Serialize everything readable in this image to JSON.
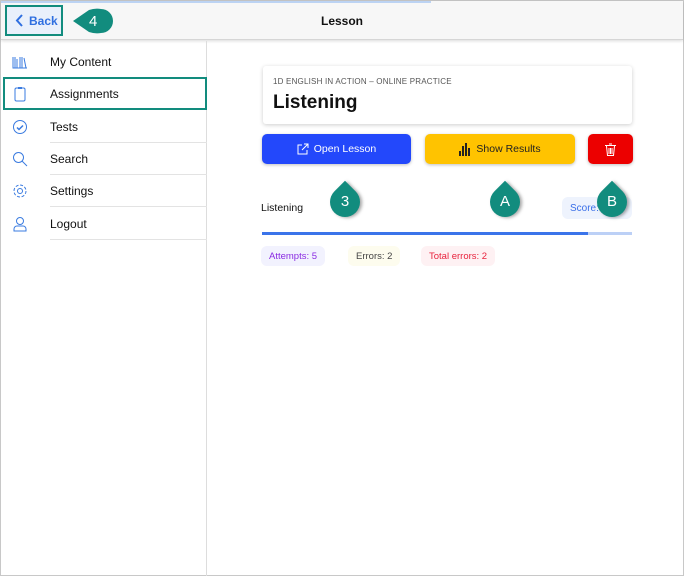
{
  "header": {
    "title": "Lesson",
    "back_label": "Back"
  },
  "sidebar": {
    "items": [
      {
        "label": "My Content",
        "icon": "books-icon"
      },
      {
        "label": "Assignments",
        "icon": "clipboard-icon",
        "selected": true
      },
      {
        "label": "Tests",
        "icon": "check-circle-icon"
      },
      {
        "label": "Search",
        "icon": "search-icon"
      },
      {
        "label": "Settings",
        "icon": "gear-icon"
      },
      {
        "label": "Logout",
        "icon": "user-icon"
      }
    ]
  },
  "lesson": {
    "course": "1D ENGLISH IN ACTION – ONLINE PRACTICE",
    "title": "Listening"
  },
  "actions": {
    "open": "Open Lesson",
    "results": "Show Results",
    "delete_icon": "trash-icon"
  },
  "result": {
    "name": "Listening",
    "score_label": "Score:",
    "progress_percent": 88,
    "attempts": "Attempts: 5",
    "errors": "Errors: 2",
    "total_errors": "Total errors: 2"
  },
  "callouts": {
    "back": "4",
    "open": "3",
    "results": "A",
    "delete": "B"
  },
  "colors": {
    "accent": "#128c7e",
    "blue": "#2348fb",
    "yellow": "#ffc300",
    "red": "#ec0000"
  }
}
